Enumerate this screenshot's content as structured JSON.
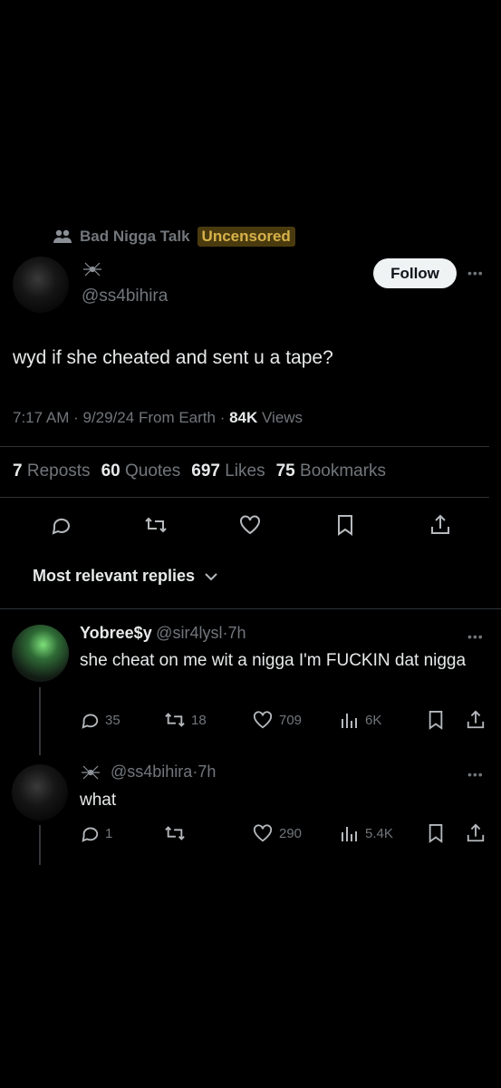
{
  "community": {
    "name": "Bad Nigga Talk",
    "badge": "Uncensored"
  },
  "post": {
    "handle": "@ss4bihira",
    "follow_label": "Follow",
    "text": "wyd if she cheated and sent u a tape?",
    "time": "7:17 AM",
    "date": "9/29/24",
    "location": "From Earth",
    "views_count": "84K",
    "views_label": "Views",
    "stats": {
      "reposts_count": "7",
      "reposts_label": "Reposts",
      "quotes_count": "60",
      "quotes_label": "Quotes",
      "likes_count": "697",
      "likes_label": "Likes",
      "bookmarks_count": "75",
      "bookmarks_label": "Bookmarks"
    }
  },
  "replies_sort": {
    "label": "Most relevant replies"
  },
  "replies": [
    {
      "name": "Yobree$y",
      "handle": "@sir4lysl",
      "time": "7h",
      "text": "she cheat on me wit a nigga I'm FUCKIN dat nigga",
      "replies": "35",
      "reposts": "18",
      "likes": "709",
      "views": "6K"
    },
    {
      "handle": "@ss4bihira",
      "time": "7h",
      "text": "what",
      "replies": "1",
      "reposts": "",
      "likes": "290",
      "views": "5.4K"
    }
  ],
  "icons": [
    "community-icon",
    "spider-icon",
    "more-icon",
    "reply-icon",
    "repost-icon",
    "like-icon",
    "bookmark-icon",
    "share-icon",
    "views-icon",
    "chevron-down-icon"
  ]
}
